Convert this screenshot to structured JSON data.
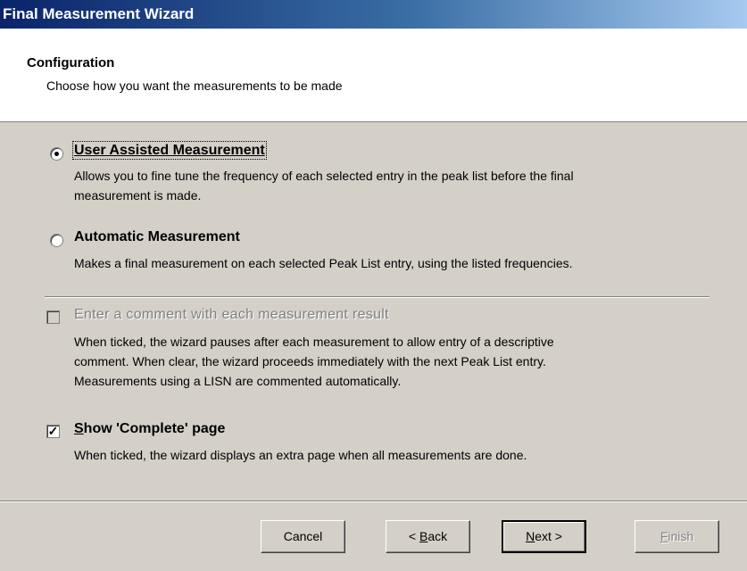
{
  "window": {
    "title": "Final Measurement Wizard"
  },
  "header": {
    "title": "Configuration",
    "subtitle": "Choose how you want the measurements to be made"
  },
  "options": {
    "user_assisted": {
      "label": "User Assisted Measurement",
      "selected": true,
      "desc_line1": "Allows you to fine tune the frequency of each selected entry in the peak list before the final",
      "desc_line2": "measurement is made."
    },
    "automatic": {
      "label": "Automatic Measurement",
      "selected": false,
      "desc_line1": "Makes a final measurement on each selected Peak List entry, using the listed frequencies."
    }
  },
  "comment_option": {
    "label": "Enter a comment with each measurement result",
    "checked": false,
    "enabled": false,
    "desc_line1": "When ticked, the wizard pauses after each measurement to allow entry of a descriptive",
    "desc_line2": "comment.  When clear, the wizard proceeds immediately with the next Peak List entry.",
    "desc_line3": "Measurements using a LISN are commented automatically."
  },
  "complete_option": {
    "label_rest": "how 'Complete' page",
    "label_accel": "S",
    "checked": true,
    "desc_line1": "When ticked, the wizard displays an extra page when all measurements are done."
  },
  "buttons": {
    "cancel": "Cancel",
    "back_prefix": "< ",
    "back_accel": "B",
    "back_rest": "ack",
    "next_accel": "N",
    "next_rest": "ext >",
    "finish_accel": "F",
    "finish_rest": "inish"
  }
}
